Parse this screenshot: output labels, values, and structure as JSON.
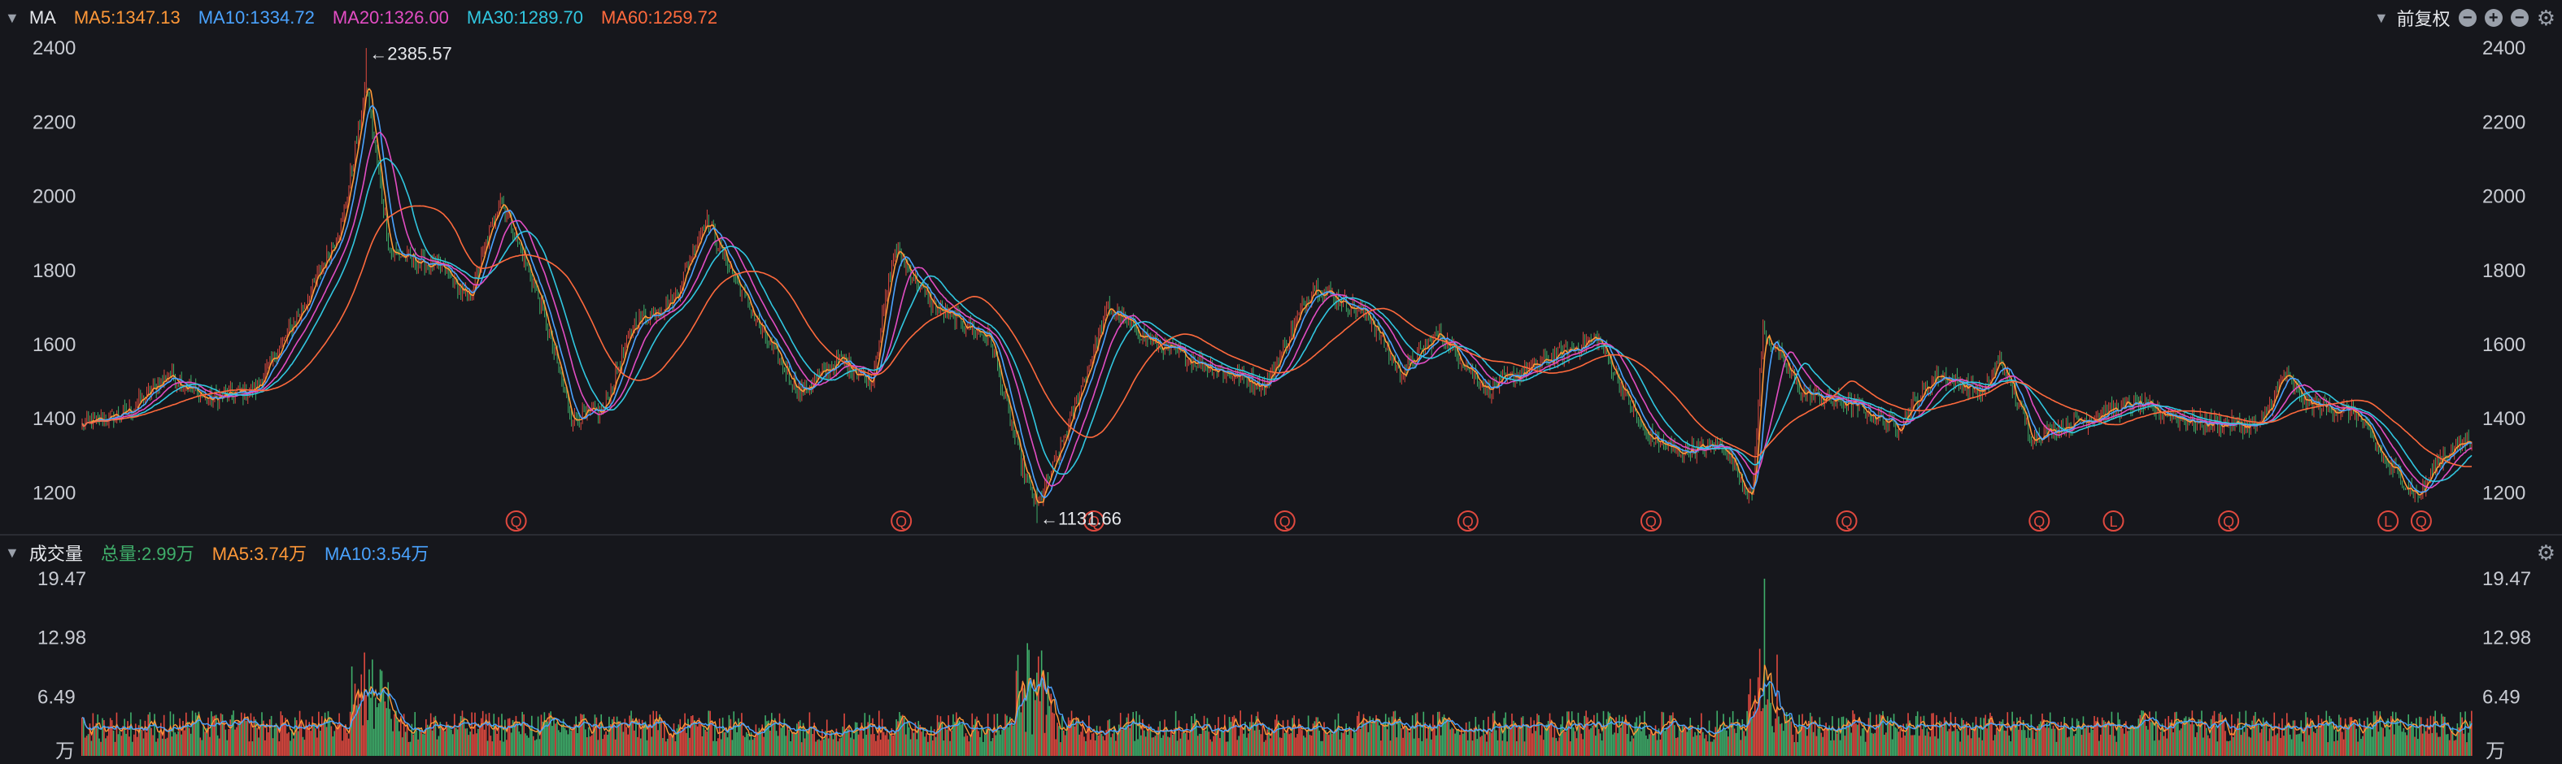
{
  "header": {
    "indicator": "MA",
    "ma5": "MA5:1347.13",
    "ma10": "MA10:1334.72",
    "ma20": "MA20:1326.00",
    "ma30": "MA30:1289.70",
    "ma60": "MA60:1259.72",
    "adjust": "前复权"
  },
  "volume_header": {
    "title": "成交量",
    "total": "总量:2.99万",
    "ma5": "MA5:3.74万",
    "ma10": "MA10:3.54万"
  },
  "colors": {
    "background": "#16171c",
    "up": "#e0493f",
    "down": "#3fae6a",
    "ma5": "#ff9838",
    "ma10": "#4aa3ff",
    "ma20": "#e24dc3",
    "ma30": "#31c7e0",
    "ma60": "#ff6a3d"
  },
  "icons": {
    "zoom_out": "minus-circle-icon",
    "zoom_in": "plus-circle-icon",
    "collapse": "minus-circle-icon",
    "settings": "gear-icon"
  },
  "chart_data": {
    "type": "candlestick",
    "price_axis": {
      "min": 1100,
      "max": 2420,
      "ticks": [
        "2400",
        "2200",
        "2000",
        "1800",
        "1600",
        "1400",
        "1200"
      ]
    },
    "annotations": {
      "high": "←2385.57",
      "low": "←1131.66"
    },
    "markers": [
      "Q",
      "Q",
      "Q",
      "Q",
      "Q",
      "Q",
      "Q",
      "Q",
      "L",
      "Q",
      "L",
      "Q"
    ],
    "trend": [
      [
        0,
        1380
      ],
      [
        30,
        1420
      ],
      [
        55,
        1520
      ],
      [
        80,
        1450
      ],
      [
        110,
        1480
      ],
      [
        140,
        1700
      ],
      [
        165,
        1930
      ],
      [
        180,
        2300
      ],
      [
        195,
        1850
      ],
      [
        230,
        1800
      ],
      [
        245,
        1720
      ],
      [
        265,
        2000
      ],
      [
        290,
        1720
      ],
      [
        310,
        1400
      ],
      [
        330,
        1420
      ],
      [
        350,
        1660
      ],
      [
        375,
        1720
      ],
      [
        395,
        1940
      ],
      [
        430,
        1640
      ],
      [
        455,
        1470
      ],
      [
        480,
        1560
      ],
      [
        500,
        1500
      ],
      [
        515,
        1860
      ],
      [
        540,
        1700
      ],
      [
        575,
        1620
      ],
      [
        595,
        1280
      ],
      [
        605,
        1160
      ],
      [
        620,
        1320
      ],
      [
        650,
        1700
      ],
      [
        680,
        1600
      ],
      [
        715,
        1540
      ],
      [
        750,
        1490
      ],
      [
        780,
        1760
      ],
      [
        815,
        1680
      ],
      [
        835,
        1520
      ],
      [
        860,
        1630
      ],
      [
        890,
        1480
      ],
      [
        930,
        1560
      ],
      [
        960,
        1620
      ],
      [
        990,
        1360
      ],
      [
        1010,
        1310
      ],
      [
        1040,
        1330
      ],
      [
        1058,
        1180
      ],
      [
        1065,
        1640
      ],
      [
        1090,
        1470
      ],
      [
        1120,
        1440
      ],
      [
        1150,
        1380
      ],
      [
        1175,
        1520
      ],
      [
        1205,
        1470
      ],
      [
        1215,
        1560
      ],
      [
        1235,
        1350
      ],
      [
        1270,
        1400
      ],
      [
        1300,
        1440
      ],
      [
        1340,
        1390
      ],
      [
        1380,
        1380
      ],
      [
        1395,
        1520
      ],
      [
        1410,
        1440
      ],
      [
        1440,
        1420
      ],
      [
        1460,
        1280
      ],
      [
        1480,
        1190
      ],
      [
        1495,
        1300
      ],
      [
        1515,
        1350
      ]
    ],
    "volume_axis": {
      "ticks": [
        "19.47",
        "12.98",
        "6.49"
      ],
      "unit": "万"
    }
  }
}
